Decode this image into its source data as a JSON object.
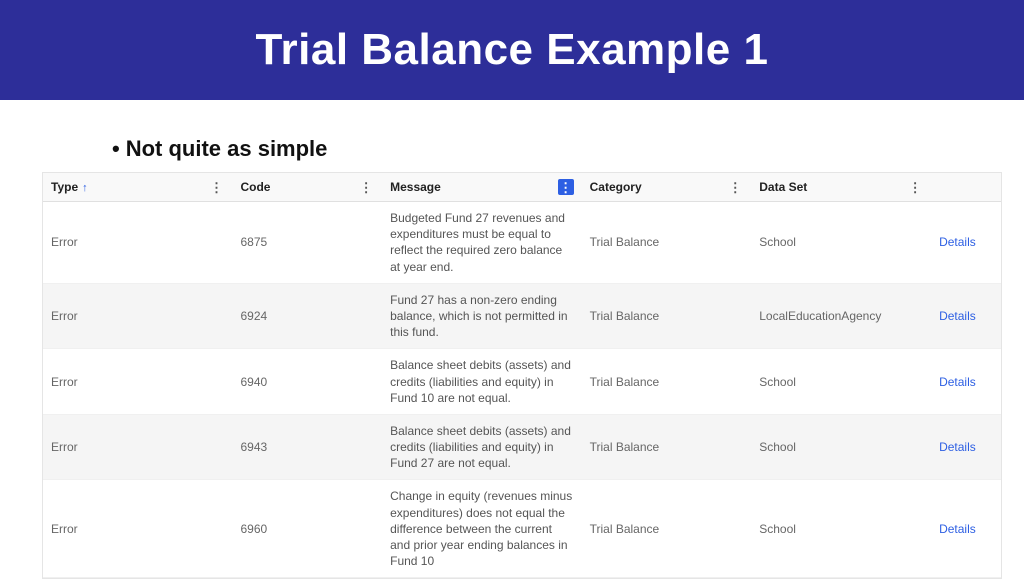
{
  "header": {
    "title": "Trial Balance Example 1"
  },
  "bullet": "Not quite as simple",
  "table": {
    "columns": {
      "type": "Type",
      "code": "Code",
      "message": "Message",
      "category": "Category",
      "dataset": "Data Set"
    },
    "active_menu_column": "message",
    "sort_column": "type",
    "rows": [
      {
        "type": "Error",
        "code": "6875",
        "message": "Budgeted Fund 27 revenues and expenditures must be equal to reflect the required zero balance at year end.",
        "category": "Trial Balance",
        "dataset": "School",
        "action": "Details"
      },
      {
        "type": "Error",
        "code": "6924",
        "message": "Fund 27 has a non-zero ending balance, which is not permitted in this fund.",
        "category": "Trial Balance",
        "dataset": "LocalEducationAgency",
        "action": "Details"
      },
      {
        "type": "Error",
        "code": "6940",
        "message": "Balance sheet debits (assets) and credits (liabilities and equity) in Fund 10 are not equal.",
        "category": "Trial Balance",
        "dataset": "School",
        "action": "Details"
      },
      {
        "type": "Error",
        "code": "6943",
        "message": "Balance sheet debits (assets) and credits (liabilities and equity) in Fund 27 are not equal.",
        "category": "Trial Balance",
        "dataset": "School",
        "action": "Details"
      },
      {
        "type": "Error",
        "code": "6960",
        "message": "Change in equity (revenues minus expenditures) does not equal the difference between the current and prior year ending balances in Fund 10",
        "category": "Trial Balance",
        "dataset": "School",
        "action": "Details"
      }
    ]
  }
}
